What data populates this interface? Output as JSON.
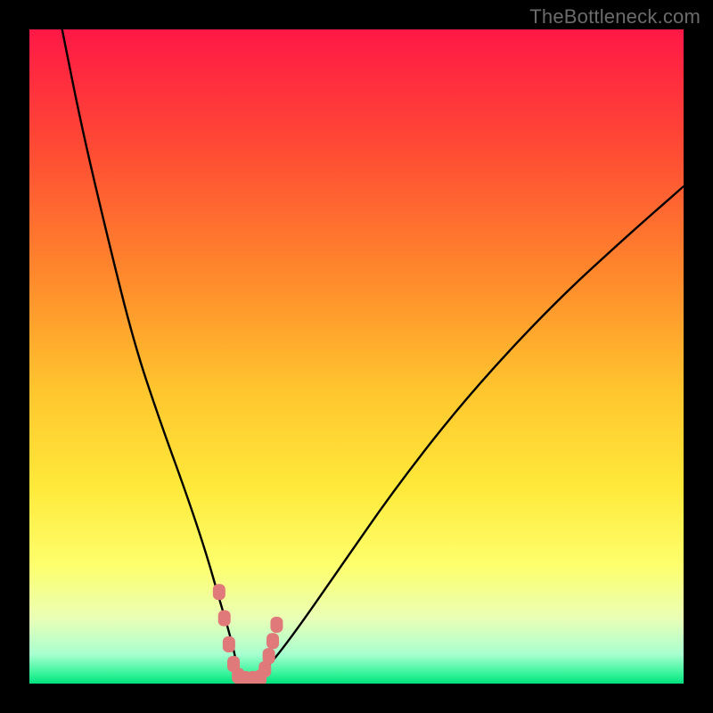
{
  "watermark": {
    "text": "TheBottleneck.com"
  },
  "chart_data": {
    "type": "line",
    "title": "",
    "xlabel": "",
    "ylabel": "",
    "xlim": [
      0,
      100
    ],
    "ylim": [
      0,
      100
    ],
    "gradient_stops": [
      {
        "offset": 0,
        "color": "#ff1846"
      },
      {
        "offset": 0.18,
        "color": "#ff4a34"
      },
      {
        "offset": 0.38,
        "color": "#ff8a2c"
      },
      {
        "offset": 0.55,
        "color": "#ffc52e"
      },
      {
        "offset": 0.7,
        "color": "#ffe93a"
      },
      {
        "offset": 0.82,
        "color": "#fdff6d"
      },
      {
        "offset": 0.9,
        "color": "#eaffb6"
      },
      {
        "offset": 0.955,
        "color": "#a8ffd0"
      },
      {
        "offset": 0.985,
        "color": "#36f49a"
      },
      {
        "offset": 1.0,
        "color": "#00e07e"
      }
    ],
    "series": [
      {
        "name": "bottleneck-curve",
        "x": [
          5,
          8,
          12,
          16,
          20,
          24,
          27,
          29,
          30.5,
          31.5,
          32,
          33,
          34,
          36,
          40,
          47,
          56,
          67,
          80,
          92,
          100
        ],
        "y": [
          100,
          85,
          68,
          52,
          40,
          29,
          20,
          13,
          8,
          4,
          1,
          0.5,
          0.7,
          2,
          7,
          17,
          30,
          44,
          58,
          69,
          76
        ]
      }
    ],
    "markers": {
      "name": "highlight-range",
      "color": "#e07a7a",
      "points": [
        {
          "x": 29.0,
          "y": 14
        },
        {
          "x": 29.8,
          "y": 10
        },
        {
          "x": 30.5,
          "y": 6
        },
        {
          "x": 31.2,
          "y": 3
        },
        {
          "x": 31.9,
          "y": 1.2
        },
        {
          "x": 33.0,
          "y": 0.7
        },
        {
          "x": 34.2,
          "y": 0.7
        },
        {
          "x": 35.3,
          "y": 0.9
        },
        {
          "x": 36.0,
          "y": 2.2
        },
        {
          "x": 36.6,
          "y": 4.2
        },
        {
          "x": 37.2,
          "y": 6.5
        },
        {
          "x": 37.8,
          "y": 9.0
        }
      ]
    }
  }
}
